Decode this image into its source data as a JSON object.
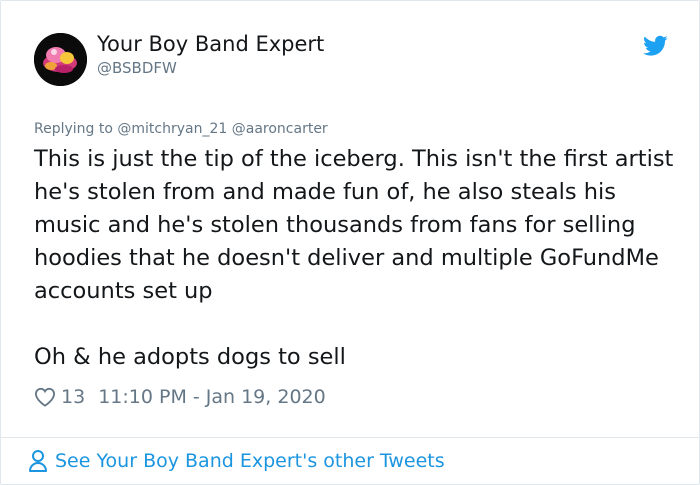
{
  "tweet": {
    "author_name": "Your Boy Band Expert",
    "author_handle": "@BSBDFW",
    "replying_to_label": "Replying to",
    "replying_to_mentions": [
      "@mitchryan_21",
      "@aaroncarter"
    ],
    "paragraphs": [
      "This is just the tip of the iceberg. This isn't the first artist he's stolen from and made fun of, he also steals his music and he's stolen thousands from fans for selling hoodies that he doesn't deliver and multiple GoFundMe accounts set up",
      "Oh & he adopts dogs to sell"
    ],
    "like_count": "13",
    "timestamp": "11:10 PM - Jan 19, 2020"
  },
  "footer": {
    "link_text": "See Your Boy Band Expert's other Tweets"
  },
  "icons": {
    "brand": "twitter-bird-icon",
    "like": "heart-icon",
    "profile": "person-icon"
  },
  "colors": {
    "twitter_blue": "#1da1f2",
    "link_blue": "#1b95e0",
    "secondary_text": "#657786",
    "primary_text": "#14171a",
    "border": "#e1e8ed"
  }
}
